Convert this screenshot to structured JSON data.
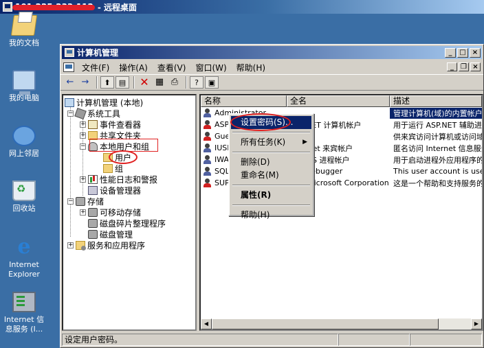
{
  "remote_desktop": {
    "ip_redacted": "101.225.233.112",
    "title": "- 远程桌面"
  },
  "desktop_icons": [
    {
      "label": "我的文档",
      "icon": "my-documents-icon"
    },
    {
      "label": "我的电脑",
      "icon": "my-computer-icon"
    },
    {
      "label": "网上邻居",
      "icon": "network-places-icon"
    },
    {
      "label": "回收站",
      "icon": "recycle-bin-icon"
    },
    {
      "label": "Internet Explorer",
      "icon": "internet-explorer-icon"
    },
    {
      "label": "Internet 信息服务 (I...",
      "icon": "iis-icon"
    }
  ],
  "window": {
    "title": "计算机管理",
    "min": "_",
    "max": "□",
    "close": "×"
  },
  "menu": {
    "items": [
      "文件(F)",
      "操作(A)",
      "查看(V)",
      "窗口(W)",
      "帮助(H)"
    ],
    "mdi_min": "_",
    "mdi_restore": "❐",
    "mdi_close": "×"
  },
  "toolbar": {
    "back": "←",
    "forward": "→",
    "up": "⬆",
    "show_tree": "▤",
    "delete": "✕",
    "properties": "▦",
    "export": "⎙",
    "help": "?",
    "extra": "▣"
  },
  "tree": {
    "root": "计算机管理 (本地)",
    "system_tools": "系统工具",
    "event_viewer": "事件查看器",
    "shared_folders": "共享文件夹",
    "local_users_groups": "本地用户和组",
    "users": "用户",
    "groups": "组",
    "perf_logs": "性能日志和警报",
    "device_manager": "设备管理器",
    "storage": "存储",
    "removable_storage": "可移动存储",
    "defrag": "磁盘碎片整理程序",
    "disk_mgmt": "磁盘管理",
    "services_apps": "服务和应用程序",
    "expand_minus": "−",
    "expand_plus": "+"
  },
  "list": {
    "columns": [
      "名称",
      "全名",
      "描述"
    ],
    "rows": [
      {
        "name": "Administrator",
        "full": "",
        "desc": "管理计算机(域)的内置帐户",
        "disabled": false
      },
      {
        "name": "ASPNET",
        "full": "ASP.NET 计算机帐户",
        "desc": "用于运行 ASP.NET 辅助进程",
        "disabled": false
      },
      {
        "name": "Guest",
        "full": "",
        "desc": "供来宾访问计算机或访问域",
        "disabled": true
      },
      {
        "name": "IUSR_",
        "full": "Internet 来宾帐户",
        "desc": "匿名访问 Internet 信息服务",
        "disabled": false
      },
      {
        "name": "IWAM_",
        "full": "启动 IIS 进程帐户",
        "desc": "用于启动进程外应用程序的",
        "disabled": false
      },
      {
        "name": "SQLDebugger",
        "full": "SQLDebugger",
        "desc": "This user account is used",
        "disabled": false
      },
      {
        "name": "SUPPORT_",
        "full": "CN=Microsoft Corporation",
        "desc": "这是一个帮助和支持服务的",
        "disabled": true
      }
    ]
  },
  "context_menu": {
    "set_password": "设置密码(S)...",
    "all_tasks": "所有任务(K)",
    "delete": "删除(D)",
    "rename": "重命名(M)",
    "properties": "属性(R)",
    "help": "帮助(H)",
    "arrow": "▶"
  },
  "status": {
    "text": "设定用户密码。"
  },
  "scroll": {
    "left": "◀",
    "right": "▶"
  },
  "colors": {
    "desktop": "#3a6ea5",
    "selection": "#0a246a",
    "annotation": "#e02020"
  }
}
